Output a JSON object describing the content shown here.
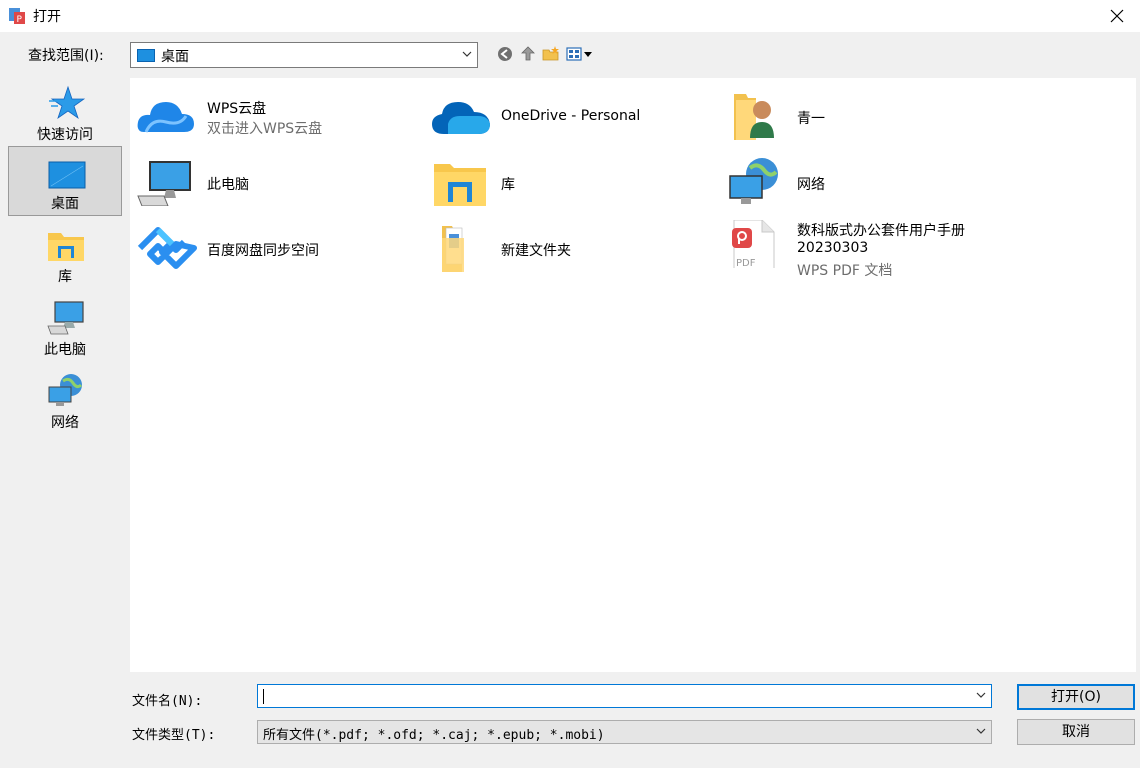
{
  "window": {
    "title": "打开"
  },
  "lookin": {
    "label": "查找范围(I):",
    "value": "桌面"
  },
  "places": [
    {
      "label": "快速访问",
      "icon": "star-icon"
    },
    {
      "label": "桌面",
      "icon": "desktop-icon",
      "selected": true
    },
    {
      "label": "库",
      "icon": "library-folder-icon"
    },
    {
      "label": "此电脑",
      "icon": "computer-icon"
    },
    {
      "label": "网络",
      "icon": "network-icon"
    }
  ],
  "items": [
    {
      "name": "WPS云盘",
      "sub": "双击进入WPS云盘",
      "icon": "cloud-icon"
    },
    {
      "name": "OneDrive - Personal",
      "icon": "onedrive-icon"
    },
    {
      "name": "青一",
      "icon": "user-folder-icon"
    },
    {
      "name": "此电脑",
      "icon": "computer-icon"
    },
    {
      "name": "库",
      "icon": "library-folder-icon"
    },
    {
      "name": "网络",
      "icon": "network-icon"
    },
    {
      "name": "百度网盘同步空间",
      "icon": "baidu-netdisk-icon"
    },
    {
      "name": "新建文件夹",
      "icon": "folder-icon"
    },
    {
      "name": "数科版式办公套件用户手册",
      "name2": "20230303",
      "sub": "WPS PDF 文档",
      "icon": "pdf-file-icon"
    }
  ],
  "bottom": {
    "filename_label": "文件名(N):",
    "filename_value": "",
    "filetype_label": "文件类型(T):",
    "filetype_value": "所有文件(*.pdf; *.ofd; *.caj; *.epub; *.mobi)",
    "open_label": "打开(O)",
    "cancel_label": "取消"
  },
  "colors": {
    "accent": "#0078d7",
    "selected_bg": "#d9d9d9"
  }
}
